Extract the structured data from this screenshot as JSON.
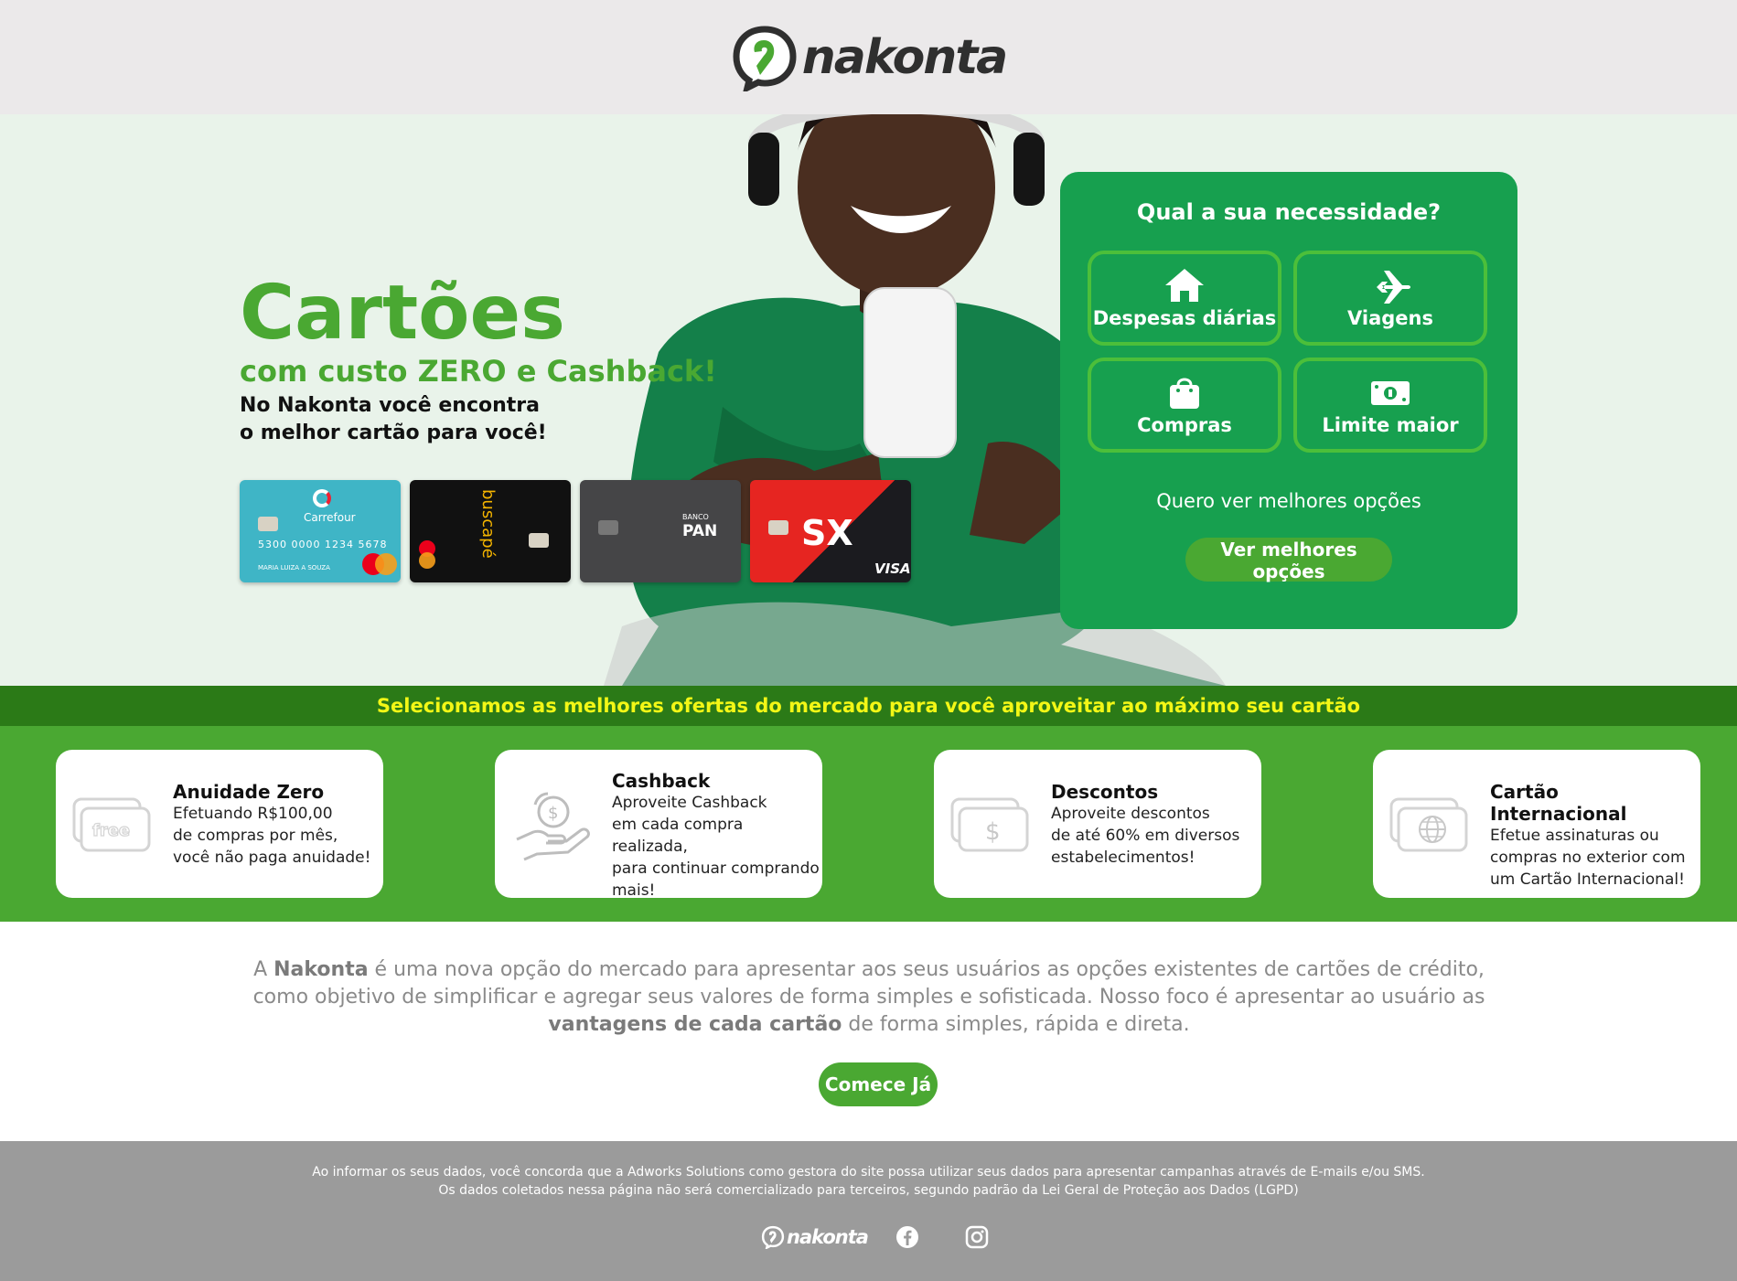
{
  "header": {
    "logo_text": "nakonta"
  },
  "hero": {
    "title": "Cartões",
    "subtitle": "com custo ZERO e Cashback!",
    "text_line1": "No Nakonta você encontra",
    "text_line2": "o melhor cartão para você!",
    "cards": {
      "carrefour": {
        "brand": "Carrefour",
        "number": "5300 0000 1234 5678",
        "holder": "MARIA LUIZA A SOUZA"
      },
      "buscape": {
        "brand": "buscapé"
      },
      "pan": {
        "brand_small": "BANCO",
        "brand": "PAN"
      },
      "sx": {
        "brand": "SX",
        "network": "VISA"
      }
    }
  },
  "needs": {
    "title": "Qual a sua necessidade?",
    "options": [
      {
        "label": "Despesas diárias",
        "icon": "home-icon"
      },
      {
        "label": "Viagens",
        "icon": "airplane-icon"
      },
      {
        "label": "Compras",
        "icon": "shopping-bag-icon"
      },
      {
        "label": "Limite maior",
        "icon": "money-icon"
      }
    ],
    "more_text": "Quero ver melhores opções",
    "button_label": "Ver melhores opções"
  },
  "banner": {
    "text": "Selecionamos as melhores ofertas do mercado para você aproveitar ao máximo seu cartão"
  },
  "benefits": [
    {
      "title": "Anuidade Zero",
      "desc": "Efetuando R$100,00\nde compras por mês,\nvocê não paga anuidade!",
      "icon": "free-card-icon",
      "icon_text": "free"
    },
    {
      "title": "Cashback",
      "desc": "Aproveite Cashback\nem cada compra realizada,\npara continuar comprando\nmais!",
      "icon": "cashback-hand-icon"
    },
    {
      "title": "Descontos",
      "desc": "Aproveite descontos\nde até 60% em diversos\nestabelecimentos!",
      "icon": "dollar-card-icon"
    },
    {
      "title": "Cartão Internacional",
      "desc": "Efetue assinaturas ou\ncompras no exterior com\num Cartão Internacional!",
      "icon": "globe-card-icon"
    }
  ],
  "about": {
    "p1": "A ",
    "brand": "Nakonta",
    "p2": " é uma nova opção do mercado para apresentar aos seus usuários as opções existentes de cartões de crédito, como objetivo de simplificar e agregar seus valores de forma simples e sofisticada. Nosso foco é apresentar ao usuário as ",
    "emph": "vantagens de cada cartão",
    "p3": " de forma simples, rápida e direta.",
    "cta": "Comece Já"
  },
  "footer": {
    "line1": "Ao informar os seus dados, você concorda que a Adworks Solutions como gestora do site possa utilizar seus dados para apresentar campanhas através de E-mails e/ou SMS.",
    "line2": "Os dados coletados nessa página não será comercializado para terceiros, segundo padrão da Lei Geral de Proteção aos Dados (LGPD)",
    "logo_text": "nakonta"
  },
  "colors": {
    "green": "#4aa832",
    "panel_green": "#17a04f",
    "dark_green": "#2b7a17",
    "banner_yellow": "#f3f716",
    "footer_gray": "#9b9b9b"
  }
}
